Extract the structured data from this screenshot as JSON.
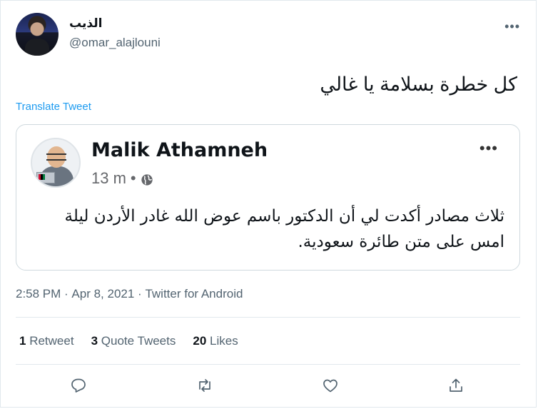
{
  "author": {
    "display_name": "الذيب",
    "handle": "@omar_alajlouni"
  },
  "tweet_text": "كل خطرة بسلامة يا غالي",
  "translate_label": "Translate Tweet",
  "quote": {
    "author_name": "Malik Athamneh",
    "time_ago": "13 m",
    "separator": "•",
    "text": "ثلاث مصادر أكدت لي أن الدكتور باسم عوض الله غادر الأردن ليلة امس على متن طائرة سعودية."
  },
  "meta": {
    "time": "2:58 PM",
    "sep": " · ",
    "date": "Apr 8, 2021",
    "source": "Twitter for Android"
  },
  "stats": {
    "retweets_count": "1",
    "retweets_label": "Retweet",
    "quote_count": "3",
    "quote_label": "Quote Tweets",
    "likes_count": "20",
    "likes_label": "Likes"
  },
  "icons": {
    "more": "•••",
    "reply": "reply-icon",
    "retweet": "retweet-icon",
    "like": "like-icon",
    "share": "share-icon"
  },
  "colors": {
    "link": "#1d9bf0",
    "secondary_text": "#536471",
    "border": "#cfd9de"
  }
}
